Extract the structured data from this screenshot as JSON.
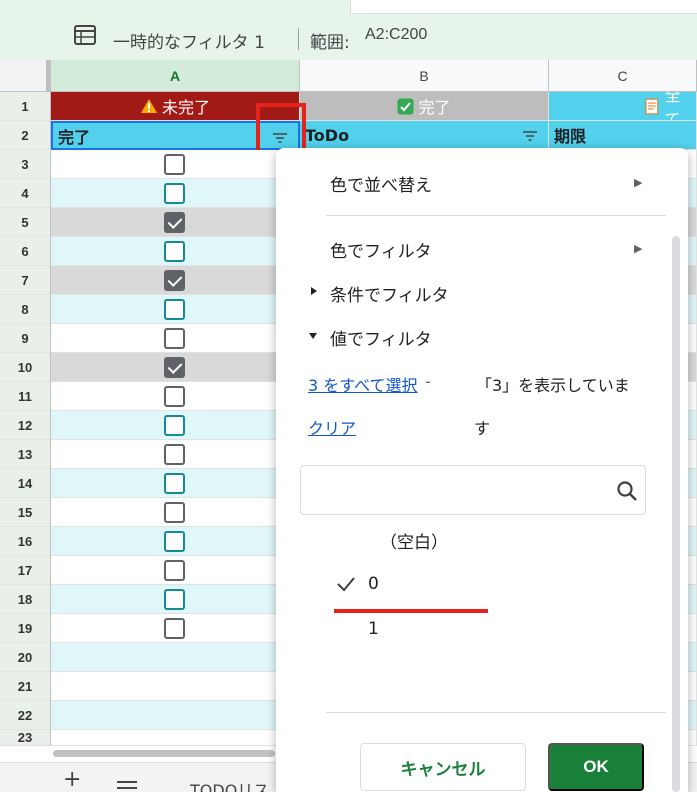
{
  "filter_bar": {
    "view_name": "一時的なフィルタ 1",
    "range_label": "範囲:",
    "range_value": "A2:C200"
  },
  "columns": [
    "A",
    "B",
    "C"
  ],
  "row_numbers": [
    "1",
    "2",
    "3",
    "4",
    "5",
    "6",
    "7",
    "8",
    "9",
    "10",
    "11",
    "12",
    "13",
    "14",
    "15",
    "16",
    "17",
    "18",
    "19",
    "20",
    "21",
    "22",
    "23"
  ],
  "header_row1": {
    "a": {
      "icon": "warning-icon",
      "text": "未完了"
    },
    "b": {
      "icon": "checkbox-icon",
      "text": "完了"
    },
    "c": {
      "icon": "memo-icon",
      "text": "全て"
    }
  },
  "header_row2": {
    "a": "完了",
    "b": "ToDo",
    "c": "期限"
  },
  "checkboxes": [
    {
      "row": "3",
      "state": "unchecked"
    },
    {
      "row": "4",
      "state": "unchecked"
    },
    {
      "row": "5",
      "state": "checked"
    },
    {
      "row": "6",
      "state": "unchecked"
    },
    {
      "row": "7",
      "state": "checked"
    },
    {
      "row": "8",
      "state": "unchecked"
    },
    {
      "row": "9",
      "state": "unchecked"
    },
    {
      "row": "10",
      "state": "checked"
    },
    {
      "row": "11",
      "state": "unchecked"
    },
    {
      "row": "12",
      "state": "unchecked"
    },
    {
      "row": "13",
      "state": "unchecked"
    },
    {
      "row": "14",
      "state": "unchecked"
    },
    {
      "row": "15",
      "state": "unchecked"
    },
    {
      "row": "16",
      "state": "unchecked"
    },
    {
      "row": "17",
      "state": "unchecked"
    },
    {
      "row": "18",
      "state": "unchecked"
    },
    {
      "row": "19",
      "state": "unchecked"
    }
  ],
  "filter_panel": {
    "sort_by_color": "色で並べ替え",
    "filter_by_color": "色でフィルタ",
    "filter_by_condition": "条件でフィルタ",
    "filter_by_values": "値でフィルタ",
    "select_all": "3 をすべて選択",
    "dash": "-",
    "clear": "クリア",
    "status_line1": "「3」を表示していま",
    "status_line2": "す",
    "search_placeholder": "",
    "values": [
      {
        "label": "（空白）",
        "checked": false
      },
      {
        "label": "0",
        "checked": true
      },
      {
        "label": "1",
        "checked": false
      }
    ],
    "cancel_label": "キャンセル",
    "ok_label": "OK"
  },
  "sheet_tab": "TODOリス",
  "colors": {
    "accent_green": "#188038",
    "header_red": "#a11a16",
    "header_gray": "#bdbdbd",
    "header_cyan": "#52d1ec",
    "highlight_red": "#e5231b",
    "link_blue": "#1155cc"
  }
}
